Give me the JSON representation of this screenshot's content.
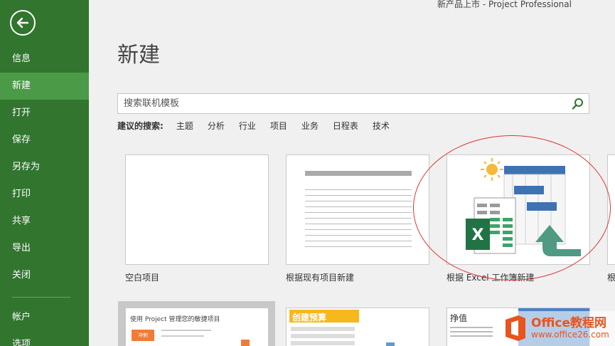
{
  "window": {
    "title": "新产品上市 - Project Professional"
  },
  "sidebar": {
    "items": [
      {
        "label": "信息"
      },
      {
        "label": "新建"
      },
      {
        "label": "打开"
      },
      {
        "label": "保存"
      },
      {
        "label": "另存为"
      },
      {
        "label": "打印"
      },
      {
        "label": "共享"
      },
      {
        "label": "导出"
      },
      {
        "label": "关闭"
      }
    ],
    "bottom_items": [
      {
        "label": "帐户"
      },
      {
        "label": "选项"
      }
    ],
    "active_index": 1,
    "color": "#31752f",
    "active_color": "#4b9a48"
  },
  "main": {
    "title": "新建",
    "search": {
      "placeholder": "搜索联机模板",
      "icon": "search-icon"
    },
    "suggestions": {
      "label": "建议的搜索:",
      "tags": [
        "主题",
        "分析",
        "行业",
        "项目",
        "业务",
        "日程表",
        "技术"
      ]
    },
    "templates": [
      {
        "label": "空白项目"
      },
      {
        "label": "根据现有项目新建"
      },
      {
        "label": "根据 Excel 工作簿新建"
      },
      {
        "label": "根"
      }
    ],
    "templates_row2": [
      {
        "title": "使用 Project 管理您的敏捷项目",
        "button": "冲刺"
      },
      {
        "title": "创建预算"
      },
      {
        "title": "挣值"
      }
    ]
  },
  "watermark": {
    "brand": "Office教程网",
    "url": "www.office26.com"
  }
}
